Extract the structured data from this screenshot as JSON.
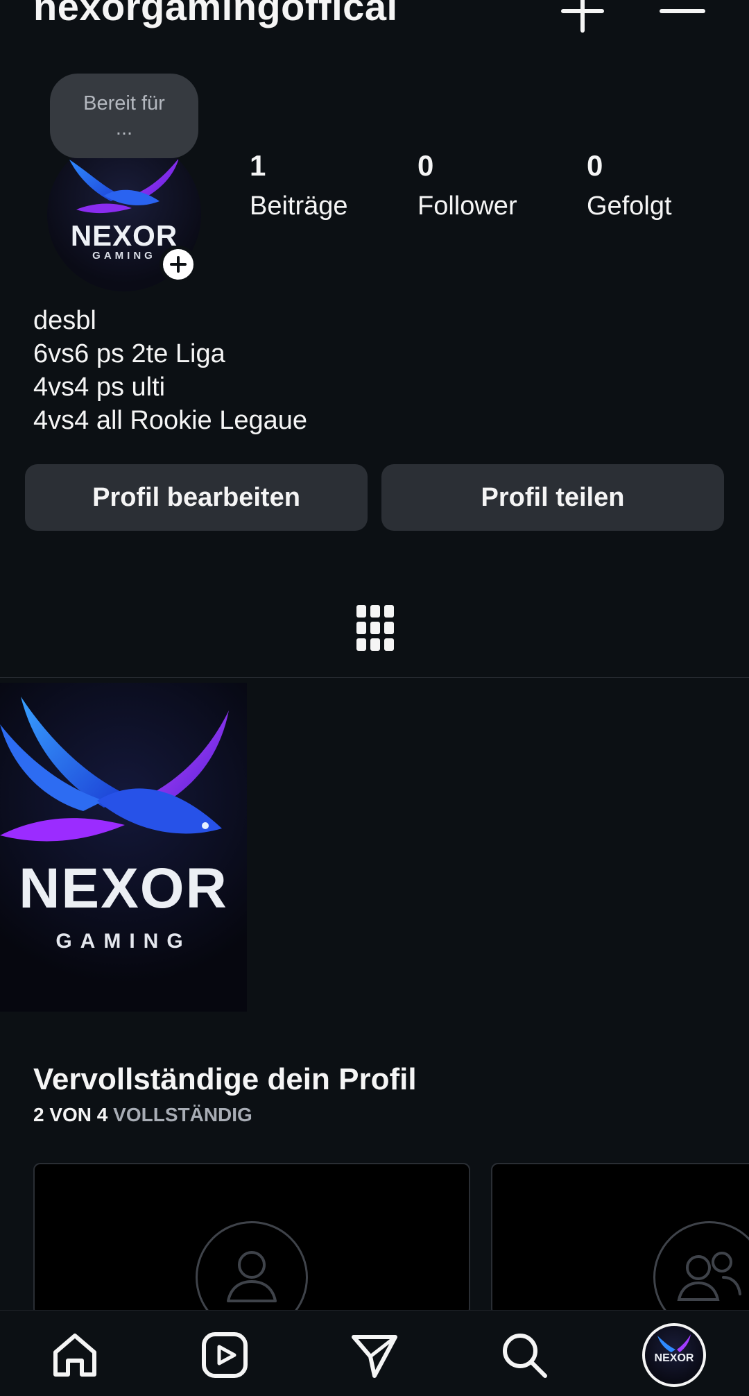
{
  "header": {
    "username": "nexorgamingoffical"
  },
  "profile": {
    "note": "Bereit für ...",
    "avatar_brand": "NEXOR",
    "avatar_sub": "GAMING",
    "stats": [
      {
        "value": "1",
        "label": "Beiträge"
      },
      {
        "value": "0",
        "label": "Follower"
      },
      {
        "value": "0",
        "label": "Gefolgt"
      }
    ],
    "bio": [
      "desbl",
      "6vs6 ps 2te Liga",
      "4vs4 ps ulti",
      "4vs4 all Rookie Legaue"
    ],
    "buttons": {
      "edit": "Profil bearbeiten",
      "share": "Profil teilen"
    }
  },
  "posts": [
    {
      "brand": "NEXOR",
      "sub": "GAMING"
    }
  ],
  "complete_profile": {
    "title": "Vervollständige dein Profil",
    "progress_count": "2 VON 4",
    "progress_word": "VOLLSTÄNDIG"
  },
  "bottom_nav": {
    "avatar_brand": "NEXOR"
  },
  "colors": {
    "background": "#0c1014",
    "button": "#2b2f35",
    "note_bubble": "#363a40",
    "text": "#f5f5f5",
    "muted": "#a8adb5",
    "brand_blue": "#2b7cff",
    "brand_purple": "#9b2cff"
  },
  "icons": [
    "plus-icon",
    "menu-icon",
    "grid-icon",
    "home-icon",
    "reels-icon",
    "direct-message-icon",
    "search-icon",
    "user-icon",
    "users-icon"
  ]
}
